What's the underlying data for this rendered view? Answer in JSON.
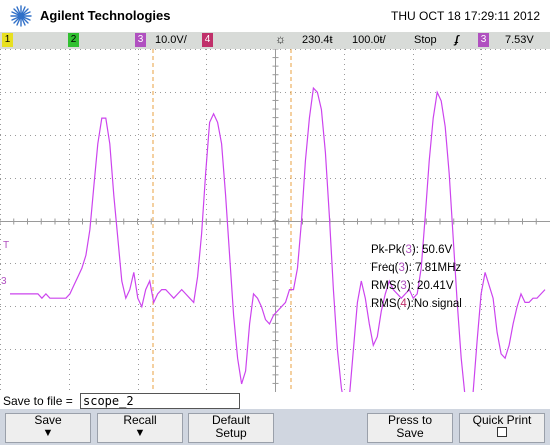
{
  "header": {
    "brand": "Agilent Technologies",
    "datetime": "THU OCT 18 17:29:11 2012"
  },
  "status": {
    "ch1": "1",
    "ch2": "2",
    "ch3": "3",
    "ch3_scale": "10.0V/",
    "ch4": "4",
    "delay": "230.4ŧ",
    "timebase": "100.0ŧ/",
    "run_state": "Stop",
    "trigger_source": "3",
    "trigger_level": "7.53V"
  },
  "markers": {
    "trigger_marker": "T",
    "ground_marker": "3"
  },
  "measurements": [
    {
      "name": "Pk-Pk",
      "channel": "3",
      "value": "50.6V"
    },
    {
      "name": "Freq",
      "channel": "3",
      "value": "7.81MHz"
    },
    {
      "name": "RMS",
      "channel": "3",
      "value": "20.41V"
    },
    {
      "name": "RMS",
      "channel": "4",
      "value": "No signal"
    }
  ],
  "save": {
    "label": "Save to file =",
    "filename": "scope_2"
  },
  "softkeys": {
    "save": "Save",
    "recall": "Recall",
    "default_line1": "Default",
    "default_line2": "Setup",
    "press_line1": "Press to",
    "press_line2": "Save",
    "quick_print": "Quick Print"
  },
  "colors": {
    "trace": "#cc44ee",
    "grid": "#9a9a9a",
    "cursor": "#e8a040",
    "ch1": "#e8e020",
    "ch2": "#30c030",
    "ch3": "#b050c0",
    "ch4": "#c0306a"
  },
  "waveform": {
    "time_per_div": "100.0ns",
    "volts_per_div": "10.0V",
    "ch3_samples_v": [
      -3,
      -3,
      -3,
      -3,
      -3,
      -3,
      -3,
      -3,
      -4,
      -3,
      -4,
      -4,
      -4,
      -4,
      -4,
      -3,
      -1,
      1,
      3,
      6,
      12,
      22,
      32,
      38,
      38,
      32,
      20,
      10,
      0,
      -4,
      -2,
      2,
      -4,
      -6,
      -2,
      0,
      -5,
      -3,
      -2,
      -2,
      -3,
      -4,
      -3,
      -2,
      -3,
      -4,
      -5,
      1,
      11,
      25,
      37,
      39,
      37,
      32,
      20,
      6,
      -8,
      -18,
      -24,
      -21,
      -10,
      -3,
      -4,
      -6,
      -9,
      -10,
      -8,
      -7,
      -6,
      -5,
      -2,
      -2,
      3,
      14,
      28,
      38,
      45,
      44,
      40,
      30,
      15,
      -2,
      -16,
      -25,
      -30,
      -27,
      -16,
      -5,
      0,
      -4,
      -10,
      -15,
      -13,
      -7,
      -3,
      0,
      -2,
      -3,
      -4,
      -3,
      -2,
      -4,
      -3,
      3,
      15,
      28,
      38,
      44,
      42,
      36,
      25,
      10,
      -5,
      -18,
      -27,
      -31,
      -26,
      -14,
      -3,
      2,
      -1,
      -4,
      -12,
      -17,
      -18,
      -15,
      -10,
      -6,
      -3,
      -5,
      -5,
      -4,
      -4,
      -3,
      -2
    ]
  }
}
